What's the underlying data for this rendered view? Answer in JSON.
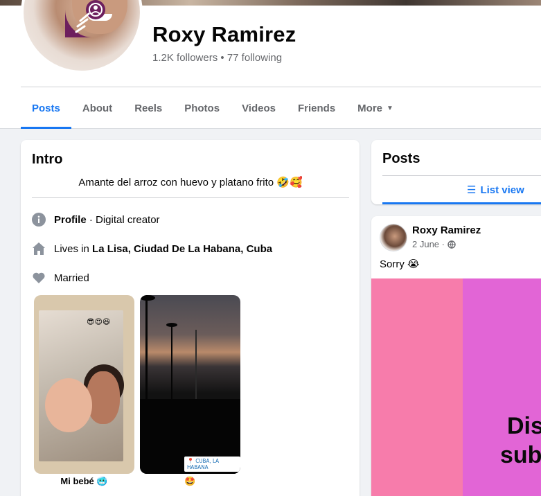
{
  "profile": {
    "name": "Roxy Ramirez",
    "followers": "1.2K followers",
    "separator": "•",
    "following": "77 following"
  },
  "tabs": [
    {
      "label": "Posts",
      "active": true
    },
    {
      "label": "About"
    },
    {
      "label": "Reels"
    },
    {
      "label": "Photos"
    },
    {
      "label": "Videos"
    },
    {
      "label": "Friends"
    },
    {
      "label": "More"
    }
  ],
  "intro": {
    "title": "Intro",
    "bio": "Amante del arroz con huevo y platano frito 🤣🥰",
    "profile_label": "Profile",
    "profile_value": "· Digital creator",
    "lives_prefix": "Lives in",
    "lives_place": "La Lisa, Ciudad De La Habana, Cuba",
    "relationship": "Married",
    "icons": [
      "info-icon",
      "home-icon",
      "heart-icon"
    ]
  },
  "stories": [
    {
      "caption": "Mi bebé 🥶",
      "overlay": "😎😍😆"
    },
    {
      "caption": "🤩",
      "location_tag": "CUBA, LA HABANA"
    }
  ],
  "posts_panel": {
    "title": "Posts",
    "list_view": "List view"
  },
  "post": {
    "author": "Roxy Ramirez",
    "date": "2 June ·",
    "text": "Sorry 😭",
    "image_text_1": "Dis",
    "image_text_2": "sub"
  },
  "colors": {
    "accent": "#1877f2",
    "muted": "#65676b",
    "background": "#f0f2f5"
  }
}
